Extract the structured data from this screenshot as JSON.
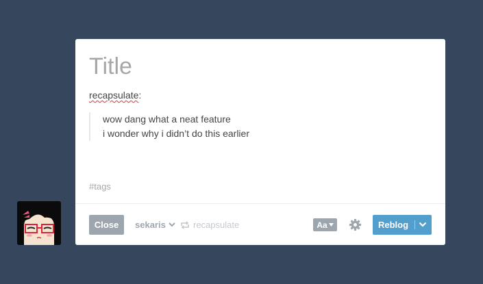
{
  "editor": {
    "title_placeholder": "Title",
    "reblog_source": "recapsulate",
    "reblog_source_suffix": ":",
    "quote_lines": [
      "wow dang what a neat feature",
      "i wonder why i didn’t do this earlier"
    ],
    "tags_placeholder": "#tags"
  },
  "footer": {
    "close_label": "Close",
    "blog_name": "sekaris",
    "reblogged_from": "recapsulate",
    "text_format_label": "Aa",
    "reblog_label": "Reblog"
  },
  "colors": {
    "background": "#36465d",
    "reblog_button": "#529ecc",
    "close_button": "#9da6af"
  },
  "icons": {
    "blog_dropdown": "chevron-down-icon",
    "reblog_from": "reblog-icon",
    "settings": "gear-icon",
    "reblog_options": "chevron-down-icon"
  }
}
